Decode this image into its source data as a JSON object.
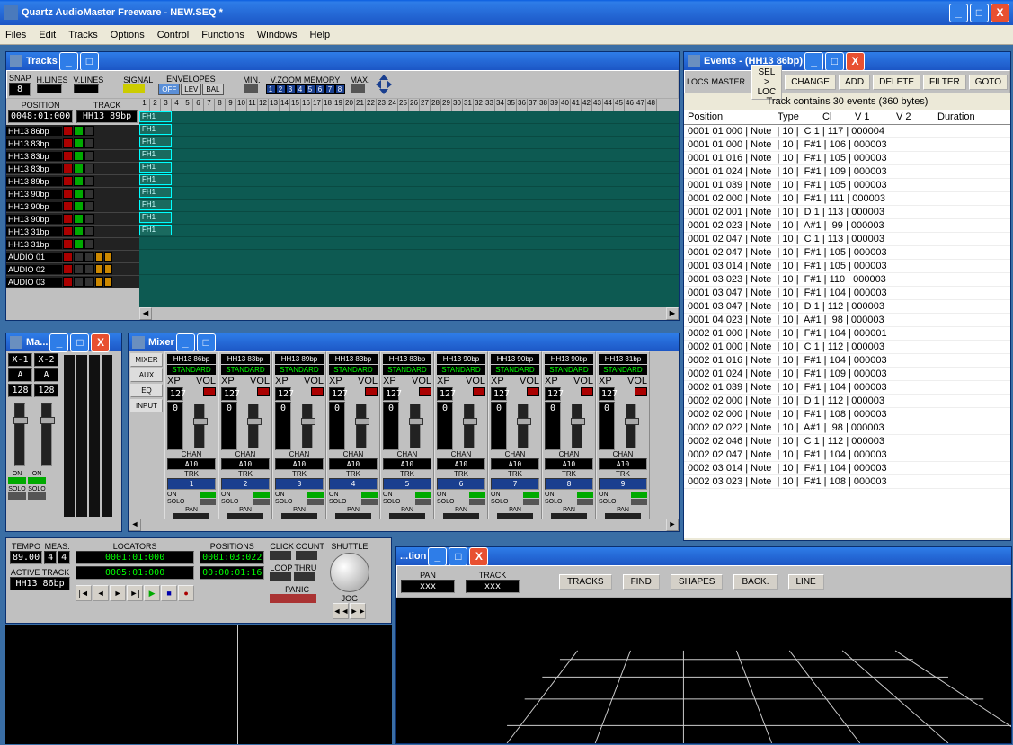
{
  "app": {
    "title": "Quartz AudioMaster Freeware - NEW.SEQ *"
  },
  "menu": [
    "Files",
    "Edit",
    "Tracks",
    "Options",
    "Control",
    "Functions",
    "Windows",
    "Help"
  ],
  "tracksWin": {
    "title": "Tracks",
    "toolbar": {
      "snap": "SNAP",
      "snap_val": "8",
      "hlines": "H.LINES",
      "vlines": "V.LINES",
      "signal": "SIGNAL",
      "envelopes": "ENVELOPES",
      "env": [
        "OFF",
        "LEV",
        "BAL"
      ],
      "min": "MIN.",
      "vzoom": "V.ZOOM MEMORY",
      "max": "MAX.",
      "position": "POSITION",
      "position_val": "0048:01:000",
      "track": "TRACK",
      "track_val": "HH13 89bp"
    },
    "tracks": [
      {
        "name": "HH13 86bp",
        "m": false,
        "s": true
      },
      {
        "name": "HH13 83bp",
        "m": false,
        "s": true
      },
      {
        "name": "HH13 83bp",
        "m": false,
        "s": true
      },
      {
        "name": "HH13 83bp",
        "m": false,
        "s": true
      },
      {
        "name": "HH13 89bp",
        "m": false,
        "s": true
      },
      {
        "name": "HH13 90bp",
        "m": false,
        "s": true
      },
      {
        "name": "HH13 90bp",
        "m": false,
        "s": true
      },
      {
        "name": "HH13 90bp",
        "m": false,
        "s": true
      },
      {
        "name": "HH13 31bp",
        "m": false,
        "s": true
      },
      {
        "name": "HH13 31bp",
        "m": false,
        "s": true
      },
      {
        "name": "AUDIO 01",
        "m": false,
        "s": false,
        "audio": true
      },
      {
        "name": "AUDIO 02",
        "m": false,
        "s": false,
        "audio": true
      },
      {
        "name": "AUDIO 03",
        "m": false,
        "s": false,
        "audio": true
      }
    ],
    "ruler": [
      1,
      2,
      3,
      4,
      5,
      6,
      7,
      8,
      9,
      10,
      11,
      12,
      13,
      14,
      15,
      16,
      17,
      18,
      19,
      20,
      21,
      22,
      23,
      24,
      25,
      26,
      27,
      28,
      29,
      30,
      31,
      32,
      33,
      34,
      35,
      36,
      37,
      38,
      39,
      40,
      41,
      42,
      43,
      44,
      45,
      46,
      47,
      48
    ]
  },
  "eventsWin": {
    "title": "Events - (HH13 86bp)",
    "toolbar": {
      "locs": "LOCS",
      "master": "MASTER",
      "sel": "SEL > LOC",
      "change": "CHANGE",
      "add": "ADD",
      "delete": "DELETE",
      "filter": "FILTER",
      "goto": "GOTO"
    },
    "status": "Track contains 30 events (360 bytes)",
    "columns": [
      "Position",
      "Type",
      "Cl",
      "V 1",
      "V 2",
      "Duration"
    ],
    "rows": [
      [
        "0001 01 000",
        "Note",
        "10",
        "C 1",
        "117",
        "000004"
      ],
      [
        "0001 01 000",
        "Note",
        "10",
        "F#1",
        "106",
        "000003"
      ],
      [
        "0001 01 016",
        "Note",
        "10",
        "F#1",
        "105",
        "000003"
      ],
      [
        "0001 01 024",
        "Note",
        "10",
        "F#1",
        "109",
        "000003"
      ],
      [
        "0001 01 039",
        "Note",
        "10",
        "F#1",
        "105",
        "000003"
      ],
      [
        "0001 02 000",
        "Note",
        "10",
        "F#1",
        "111",
        "000003"
      ],
      [
        "0001 02 001",
        "Note",
        "10",
        "D 1",
        "113",
        "000003"
      ],
      [
        "0001 02 023",
        "Note",
        "10",
        "A#1",
        " 99",
        "000003"
      ],
      [
        "0001 02 047",
        "Note",
        "10",
        "C 1",
        "113",
        "000003"
      ],
      [
        "0001 02 047",
        "Note",
        "10",
        "F#1",
        "105",
        "000003"
      ],
      [
        "0001 03 014",
        "Note",
        "10",
        "F#1",
        "105",
        "000003"
      ],
      [
        "0001 03 023",
        "Note",
        "10",
        "F#1",
        "110",
        "000003"
      ],
      [
        "0001 03 047",
        "Note",
        "10",
        "F#1",
        "104",
        "000003"
      ],
      [
        "0001 03 047",
        "Note",
        "10",
        "D 1",
        "112",
        "000003"
      ],
      [
        "0001 04 023",
        "Note",
        "10",
        "A#1",
        " 98",
        "000003"
      ],
      [
        "0002 01 000",
        "Note",
        "10",
        "F#1",
        "104",
        "000001"
      ],
      [
        "0002 01 000",
        "Note",
        "10",
        "C 1",
        "112",
        "000003"
      ],
      [
        "0002 01 016",
        "Note",
        "10",
        "F#1",
        "104",
        "000003"
      ],
      [
        "0002 01 024",
        "Note",
        "10",
        "F#1",
        "109",
        "000003"
      ],
      [
        "0002 01 039",
        "Note",
        "10",
        "F#1",
        "104",
        "000003"
      ],
      [
        "0002 02 000",
        "Note",
        "10",
        "D 1",
        "112",
        "000003"
      ],
      [
        "0002 02 000",
        "Note",
        "10",
        "F#1",
        "108",
        "000003"
      ],
      [
        "0002 02 022",
        "Note",
        "10",
        "A#1",
        " 98",
        "000003"
      ],
      [
        "0002 02 046",
        "Note",
        "10",
        "C 1",
        "112",
        "000003"
      ],
      [
        "0002 02 047",
        "Note",
        "10",
        "F#1",
        "104",
        "000003"
      ],
      [
        "0002 03 014",
        "Note",
        "10",
        "F#1",
        "104",
        "000003"
      ],
      [
        "0002 03 023",
        "Note",
        "10",
        "F#1",
        "108",
        "000003"
      ]
    ]
  },
  "mixerWin": {
    "title": "Mixer",
    "side": [
      "MIXER",
      "AUX",
      "EQ",
      "INPUT"
    ],
    "strips": [
      {
        "name": "HH13 86bp",
        "std": "STANDARD",
        "xp": "127",
        "vol": "VOL",
        "ch": "CHAN",
        "cha": "A10",
        "trk": "TRK",
        "tn": "1",
        "on": "ON",
        "solo": "SOLO",
        "pan": "PAN"
      },
      {
        "name": "HH13 83bp",
        "std": "STANDARD",
        "xp": "127",
        "vol": "VOL",
        "ch": "CHAN",
        "cha": "A10",
        "trk": "TRK",
        "tn": "2",
        "on": "ON",
        "solo": "SOLO",
        "pan": "PAN"
      },
      {
        "name": "HH13 89bp",
        "std": "STANDARD",
        "xp": "127",
        "vol": "VOL",
        "ch": "CHAN",
        "cha": "A10",
        "trk": "TRK",
        "tn": "3",
        "on": "ON",
        "solo": "SOLO",
        "pan": "PAN"
      },
      {
        "name": "HH13 83bp",
        "std": "STANDARD",
        "xp": "127",
        "vol": "VOL",
        "ch": "CHAN",
        "cha": "A10",
        "trk": "TRK",
        "tn": "4",
        "on": "ON",
        "solo": "SOLO",
        "pan": "PAN"
      },
      {
        "name": "HH13 83bp",
        "std": "STANDARD",
        "xp": "127",
        "vol": "VOL",
        "ch": "CHAN",
        "cha": "A10",
        "trk": "TRK",
        "tn": "5",
        "on": "ON",
        "solo": "SOLO",
        "pan": "PAN"
      },
      {
        "name": "HH13 90bp",
        "std": "STANDARD",
        "xp": "127",
        "vol": "VOL",
        "ch": "CHAN",
        "cha": "A10",
        "trk": "TRK",
        "tn": "6",
        "on": "ON",
        "solo": "SOLO",
        "pan": "PAN"
      },
      {
        "name": "HH13 90bp",
        "std": "STANDARD",
        "xp": "127",
        "vol": "VOL",
        "ch": "CHAN",
        "cha": "A10",
        "trk": "TRK",
        "tn": "7",
        "on": "ON",
        "solo": "SOLO",
        "pan": "PAN"
      },
      {
        "name": "HH13 90bp",
        "std": "STANDARD",
        "xp": "127",
        "vol": "VOL",
        "ch": "CHAN",
        "cha": "A10",
        "trk": "TRK",
        "tn": "8",
        "on": "ON",
        "solo": "SOLO",
        "pan": "PAN"
      },
      {
        "name": "HH13 31bp",
        "std": "STANDARD",
        "xp": "127",
        "vol": "VOL",
        "ch": "CHAN",
        "cha": "A10",
        "trk": "TRK",
        "tn": "9",
        "on": "ON",
        "solo": "SOLO",
        "pan": "PAN"
      }
    ]
  },
  "masterWin": {
    "title": "Ma...",
    "x1": "X-1",
    "x2": "X-2",
    "a": "A",
    "v1": "128",
    "v2": "128",
    "on": "ON",
    "solo": "SOLO"
  },
  "transport": {
    "tempo": "TEMPO",
    "tempo_val": "89.00",
    "meas": "MEAS.",
    "m1": "4",
    "m2": "4",
    "locators": "LOCATORS",
    "l1": "0001:01:000",
    "l2": "0005:01:000",
    "positions": "POSITIONS",
    "p1": "0001:03:022",
    "p2": "00:00:01:16",
    "click": "CLICK",
    "count": "COUNT",
    "loop": "LOOP",
    "thru": "THRU",
    "panic": "PANIC",
    "shuttle": "SHUTTLE",
    "jog": "JOG",
    "active": "ACTIVE TRACK",
    "active_val": "HH13 86bp"
  },
  "bottomWin": {
    "title": "...tion",
    "pan": "PAN",
    "track": "TRACK",
    "val": "xxx",
    "tracks": "TRACKS",
    "find": "FIND",
    "shapes": "SHAPES",
    "back": "BACK.",
    "line": "LINE"
  }
}
